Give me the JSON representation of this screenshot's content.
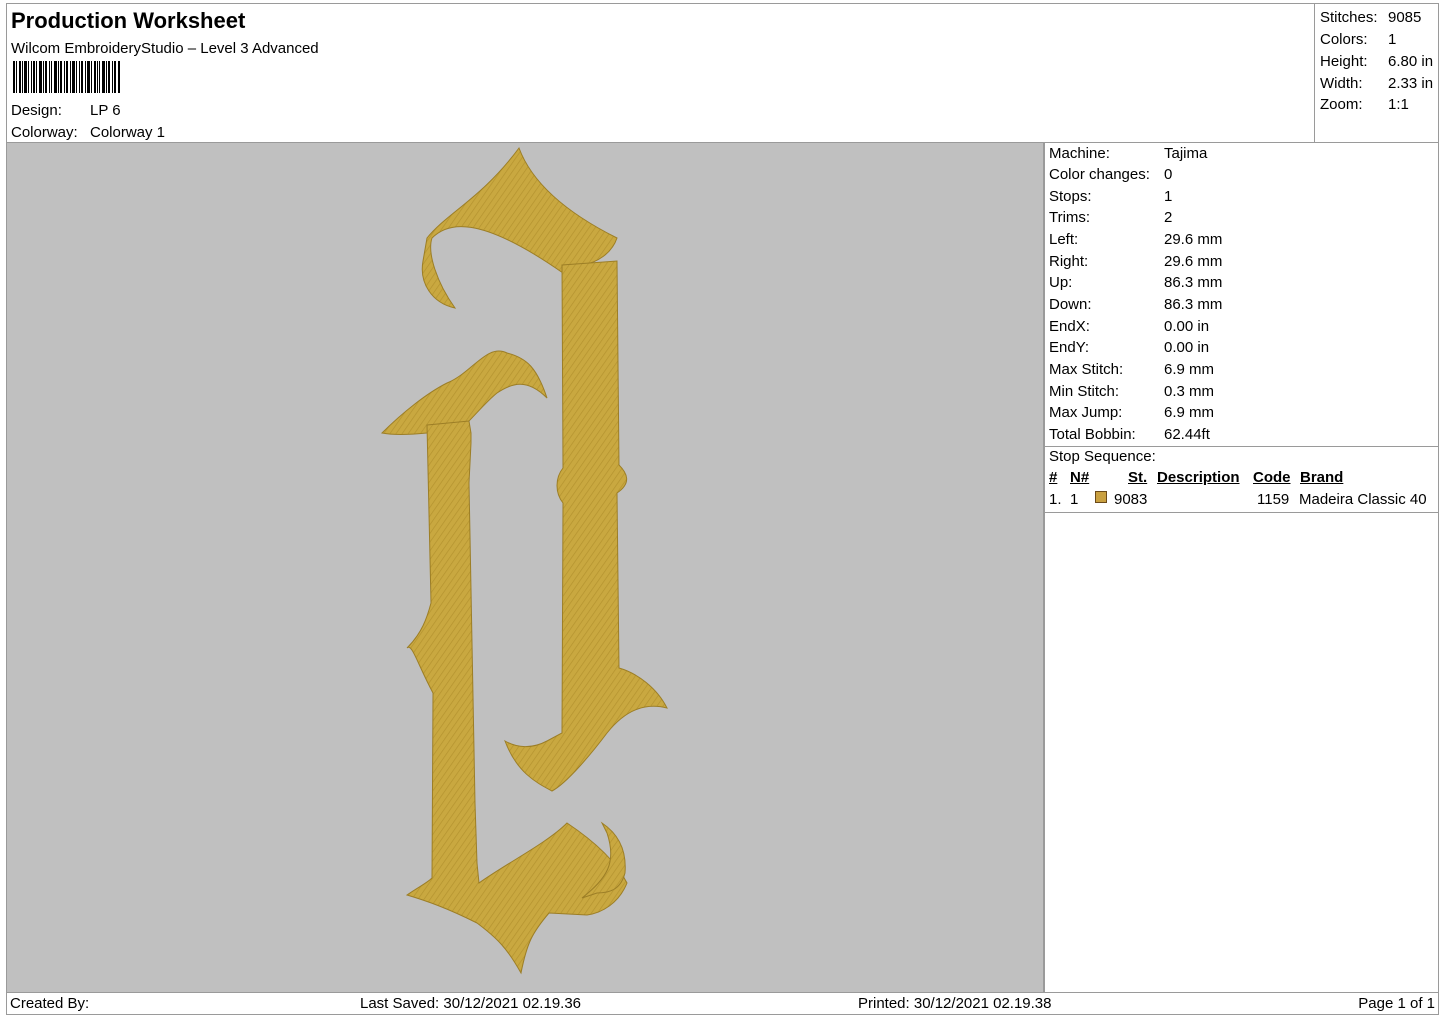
{
  "header": {
    "title": "Production Worksheet",
    "subtitle": "Wilcom EmbroideryStudio – Level 3 Advanced",
    "design_label": "Design:",
    "design_value": "LP 6",
    "colorway_label": "Colorway:",
    "colorway_value": "Colorway 1"
  },
  "stats": [
    {
      "label": "Stitches:",
      "value": "9085"
    },
    {
      "label": "Colors:",
      "value": "1"
    },
    {
      "label": "Height:",
      "value": "6.80 in"
    },
    {
      "label": "Width:",
      "value": "2.33 in"
    },
    {
      "label": "Zoom:",
      "value": "1:1"
    }
  ],
  "machine_info": [
    {
      "label": "Machine:",
      "value": "Tajima"
    },
    {
      "label": "Color changes:",
      "value": "0"
    },
    {
      "label": "Stops:",
      "value": "1"
    },
    {
      "label": "Trims:",
      "value": "2"
    },
    {
      "label": "Left:",
      "value": "29.6 mm"
    },
    {
      "label": "Right:",
      "value": "29.6 mm"
    },
    {
      "label": "Up:",
      "value": "86.3 mm"
    },
    {
      "label": "Down:",
      "value": "86.3 mm"
    },
    {
      "label": "EndX:",
      "value": "0.00 in"
    },
    {
      "label": "EndY:",
      "value": "0.00 in"
    },
    {
      "label": "Max Stitch:",
      "value": "6.9 mm"
    },
    {
      "label": "Min Stitch:",
      "value": "0.3 mm"
    },
    {
      "label": "Max Jump:",
      "value": "6.9 mm"
    },
    {
      "label": "Total Bobbin:",
      "value": "62.44ft"
    }
  ],
  "stop_sequence": {
    "title": "Stop Sequence:",
    "headers": {
      "num": "#",
      "n": "N#",
      "st": "St.",
      "description": "Description",
      "code": "Code",
      "brand": "Brand"
    },
    "rows": [
      {
        "num": "1.",
        "n": "1",
        "st": "9083",
        "description": "",
        "code": "1159",
        "brand": "Madeira Classic 40",
        "color": "#c9a040"
      }
    ]
  },
  "colors": {
    "preview_bg": "#c0c0c0",
    "thread": "#c9a840",
    "thread_shadow": "#8f7422",
    "thread_highlight": "#e2c76a"
  },
  "footer": {
    "created_by": "Created By:",
    "last_saved": "Last Saved: 30/12/2021 02.19.36",
    "printed": "Printed: 30/12/2021 02.19.38",
    "page": "Page 1 of 1"
  }
}
